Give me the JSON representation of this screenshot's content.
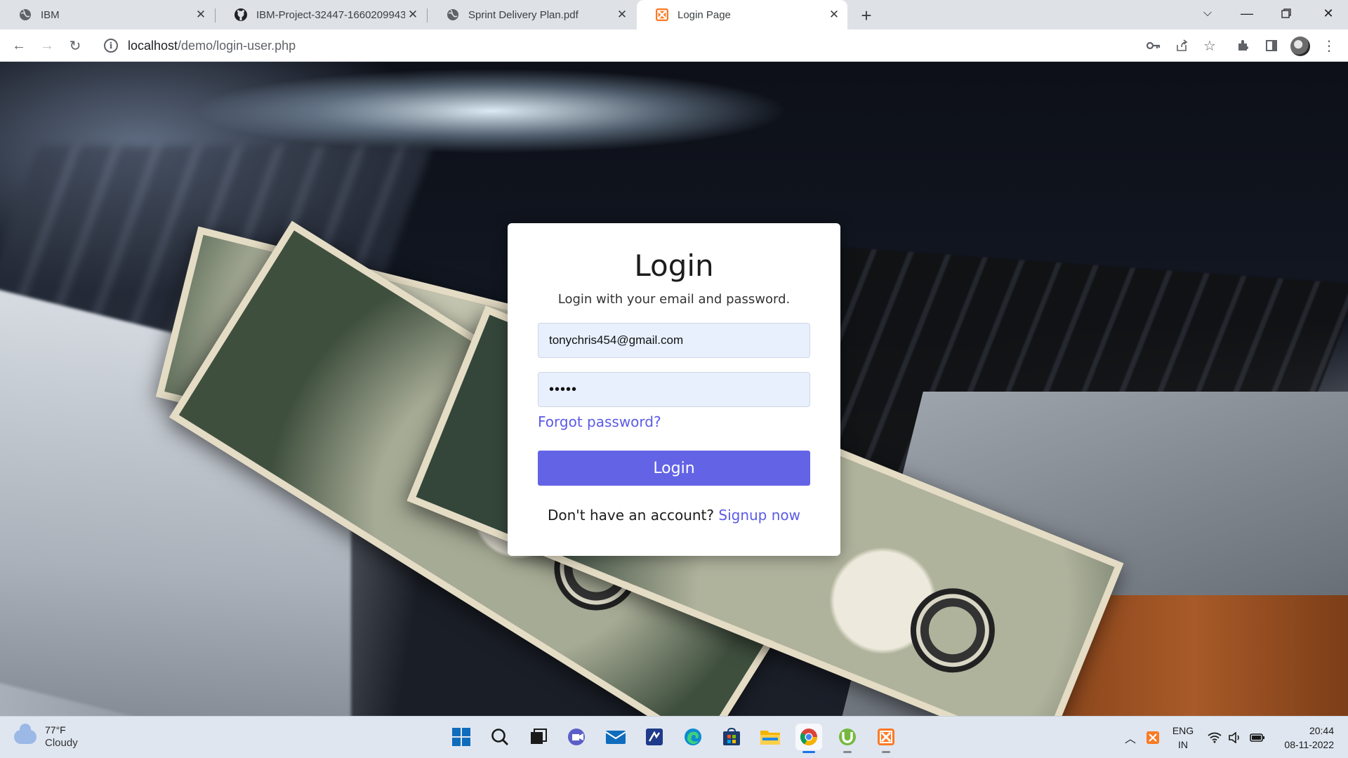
{
  "browser": {
    "tabs": [
      {
        "title": "IBM",
        "icon": "globe-icon",
        "active": false
      },
      {
        "title": "IBM-Project-32447-1660209943",
        "icon": "github-icon",
        "active": false
      },
      {
        "title": "Sprint Delivery Plan.pdf",
        "icon": "globe-icon",
        "active": false
      },
      {
        "title": "Login Page",
        "icon": "xampp-icon",
        "active": true
      }
    ],
    "url_host": "localhost",
    "url_path": "/demo/login-user.php"
  },
  "login": {
    "heading": "Login",
    "subtitle": "Login with your email and password.",
    "email_value": "tonychris454@gmail.com",
    "password_mask": "•••••",
    "forgot_label": "Forgot password?",
    "submit_label": "Login",
    "signup_prompt": "Don't have an account?",
    "signup_link": "Signup now"
  },
  "colors": {
    "accent": "#6363e6",
    "link": "#5b5be6",
    "input_bg": "#e8f0fe"
  },
  "taskbar": {
    "weather_temp": "77°F",
    "weather_condition": "Cloudy",
    "apps": [
      "start-icon",
      "search-icon",
      "task-view-icon",
      "teams-icon",
      "mail-icon",
      "app-icon",
      "edge-icon",
      "store-icon",
      "file-explorer-icon",
      "chrome-icon",
      "utorrent-icon",
      "xampp-icon"
    ],
    "lang_line1": "ENG",
    "lang_line2": "IN",
    "time": "20:44",
    "date": "08-11-2022"
  }
}
